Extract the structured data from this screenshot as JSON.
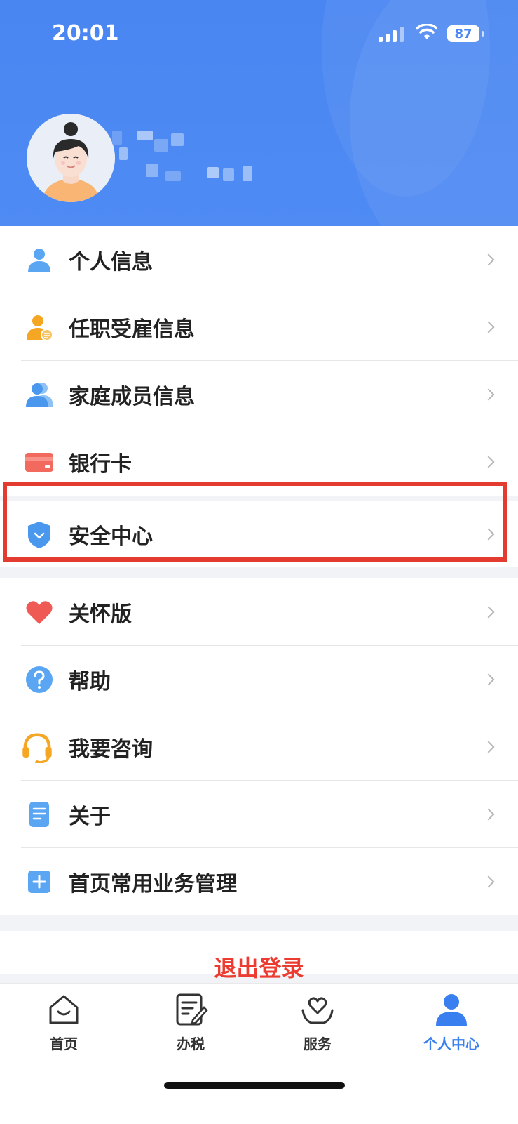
{
  "status_bar": {
    "time": "20:01",
    "battery": "87"
  },
  "profile": {
    "avatar_icon": "female-avatar-icon"
  },
  "menu_group1": [
    {
      "label": "个人信息",
      "icon": "person-icon"
    },
    {
      "label": "任职受雇信息",
      "icon": "employment-icon"
    },
    {
      "label": "家庭成员信息",
      "icon": "family-icon"
    },
    {
      "label": "银行卡",
      "icon": "bank-card-icon"
    }
  ],
  "menu_group2": [
    {
      "label": "安全中心",
      "icon": "shield-icon"
    }
  ],
  "menu_group3": [
    {
      "label": "关怀版",
      "icon": "heart-icon"
    },
    {
      "label": "帮助",
      "icon": "help-icon"
    },
    {
      "label": "我要咨询",
      "icon": "headset-icon"
    },
    {
      "label": "关于",
      "icon": "document-icon"
    },
    {
      "label": "首页常用业务管理",
      "icon": "plus-square-icon"
    }
  ],
  "logout": {
    "label": "退出登录"
  },
  "tabbar": [
    {
      "label": "首页",
      "icon": "home-icon"
    },
    {
      "label": "办税",
      "icon": "edit-document-icon"
    },
    {
      "label": "服务",
      "icon": "service-heart-icon"
    },
    {
      "label": "个人中心",
      "icon": "person-center-icon",
      "active": true
    }
  ],
  "colors": {
    "header_blue": "#4a86f2",
    "highlight_red": "#e33b2f",
    "logout_red": "#ec3c31",
    "active_tab": "#3a7ff0"
  }
}
